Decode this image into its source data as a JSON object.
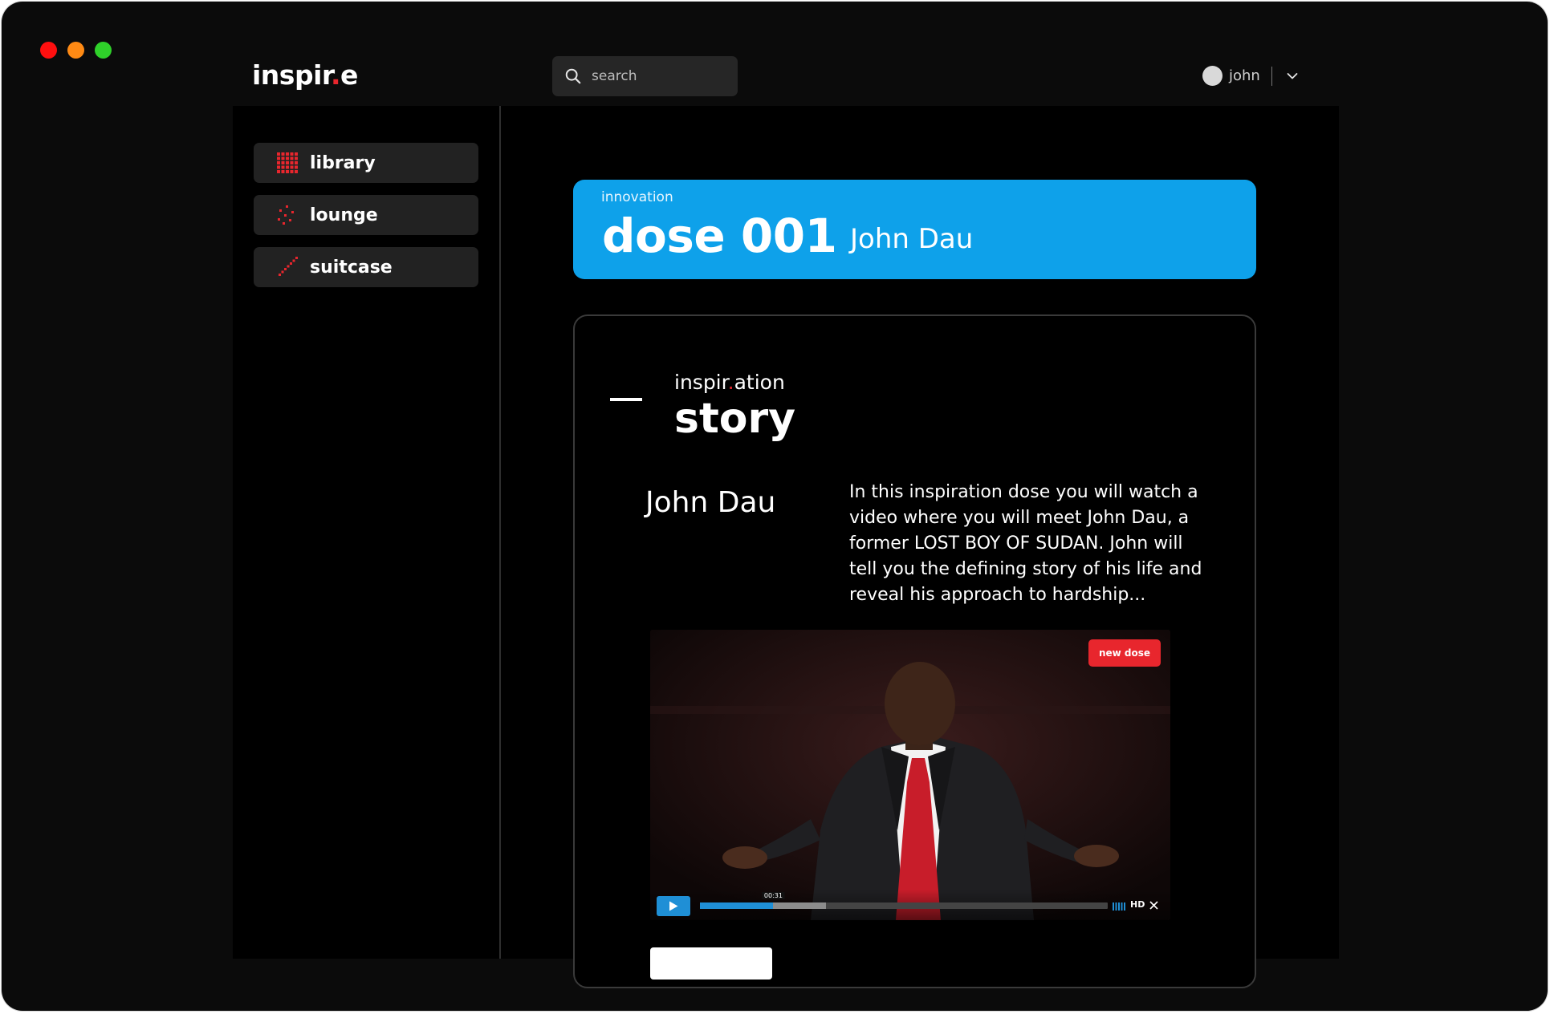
{
  "window": {
    "controls": [
      "close",
      "minimize",
      "maximize"
    ]
  },
  "header": {
    "logo_prefix": "inspir",
    "logo_dot": ".",
    "logo_suffix": "e",
    "search_placeholder": "search",
    "search_icon": "search-icon",
    "user_name": "john",
    "user_menu_icon": "chevron-down-icon"
  },
  "sidebar": {
    "items": [
      {
        "label": "library",
        "icon": "grid-icon",
        "selected": true
      },
      {
        "label": "lounge",
        "icon": "scatter-dots-icon",
        "selected": false
      },
      {
        "label": "suitcase",
        "icon": "dotted-line-icon",
        "selected": false
      }
    ]
  },
  "banner": {
    "category": "innovation",
    "dose": "dose 001",
    "speaker": "John Dau"
  },
  "card": {
    "kicker_prefix": "inspir",
    "kicker_dot": ".",
    "kicker_suffix": "ation",
    "heading": "story",
    "person": "John Dau",
    "description": "In this inspiration dose you will watch a video where you will meet John Dau, a former LOST BOY OF SUDAN. John will tell you the defining story of his life and reveal his approach to hardship..."
  },
  "video": {
    "badge": "new dose",
    "time": "00:31",
    "quality": "HD",
    "played_fraction": 0.18,
    "buffered_fraction": 0.31
  },
  "colors": {
    "accent_blue": "#0ea1ea",
    "accent_red": "#e8262d",
    "panel": "#222222",
    "background": "#000000"
  }
}
